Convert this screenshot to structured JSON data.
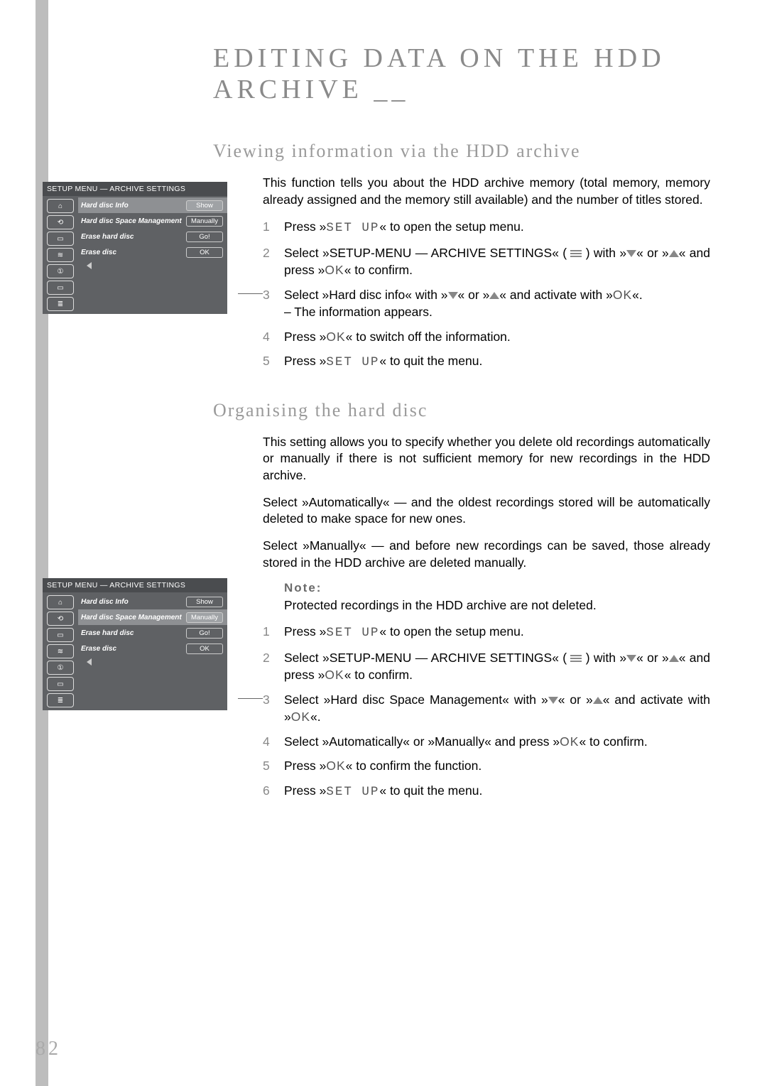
{
  "title": "EDITING DATA ON THE HDD ARCHIVE __",
  "page_number": "82",
  "section1": {
    "heading": "Viewing information via the HDD archive",
    "intro": "This function tells you about the HDD archive memory (total memory, memory already assigned and the memory still available) and the number of titles stored.",
    "steps": [
      {
        "n": "1",
        "pre": "Press »",
        "btn": "SET UP",
        "post": "« to open the setup menu."
      },
      {
        "n": "2",
        "text_a": "Select »SETUP-MENU — ARCHIVE SETTINGS« (",
        "text_b": ") with »",
        "text_c": "« or »",
        "text_d": "« and press »",
        "btn": "OK",
        "text_e": "« to confirm."
      },
      {
        "n": "3",
        "text_a": "Select »Hard disc info« with »",
        "text_b": "« or »",
        "text_c": "« and activate with »",
        "btn": "OK",
        "text_d": "«.",
        "sub": "– The information appears."
      },
      {
        "n": "4",
        "pre": "Press »",
        "btn": "OK",
        "post": "« to switch off the information."
      },
      {
        "n": "5",
        "pre": "Press »",
        "btn": "SET UP",
        "post": "« to quit the menu."
      }
    ]
  },
  "section2": {
    "heading": "Organising the hard disc",
    "p1": "This setting allows you to specify whether you delete old recordings automatically or manually if there is not sufficient memory for new recordings in the HDD archive.",
    "p2": "Select »Automatically« — and the oldest recordings stored will be automatically deleted to make space for new ones.",
    "p3": "Select »Manually« — and before new recordings can be saved, those already stored in the HDD archive are deleted manually.",
    "note_heading": "Note:",
    "note_text": "Protected recordings in the HDD archive are not deleted.",
    "steps": [
      {
        "n": "1",
        "pre": "Press »",
        "btn": "SET UP",
        "post": "« to open the setup menu."
      },
      {
        "n": "2",
        "text_a": "Select »SETUP-MENU — ARCHIVE SETTINGS« (",
        "text_b": ") with »",
        "text_c": "« or »",
        "text_d": "« and press »",
        "btn": "OK",
        "text_e": "« to confirm."
      },
      {
        "n": "3",
        "text_a": "Select »Hard disc Space Management« with »",
        "text_b": "« or »",
        "text_c": "« and activate with »",
        "btn": "OK",
        "text_d": "«."
      },
      {
        "n": "4",
        "text_a": "Select »Automatically« or »Manually« and press »",
        "btn": "OK",
        "text_b": "« to confirm."
      },
      {
        "n": "5",
        "pre": "Press »",
        "btn": "OK",
        "post": "« to confirm the function."
      },
      {
        "n": "6",
        "pre": "Press »",
        "btn": "SET UP",
        "post": "« to quit the menu."
      }
    ]
  },
  "osd": {
    "header": "SETUP MENU — ARCHIVE SETTINGS",
    "rows": [
      {
        "label": "Hard disc Info",
        "btn": "Show"
      },
      {
        "label": "Hard disc Space Management",
        "btn": "Manually"
      },
      {
        "label": "Erase hard disc",
        "btn": "Go!"
      },
      {
        "label": "Erase disc",
        "btn": "OK"
      }
    ],
    "selected_index_1": 0,
    "selected_index_2": 1
  }
}
